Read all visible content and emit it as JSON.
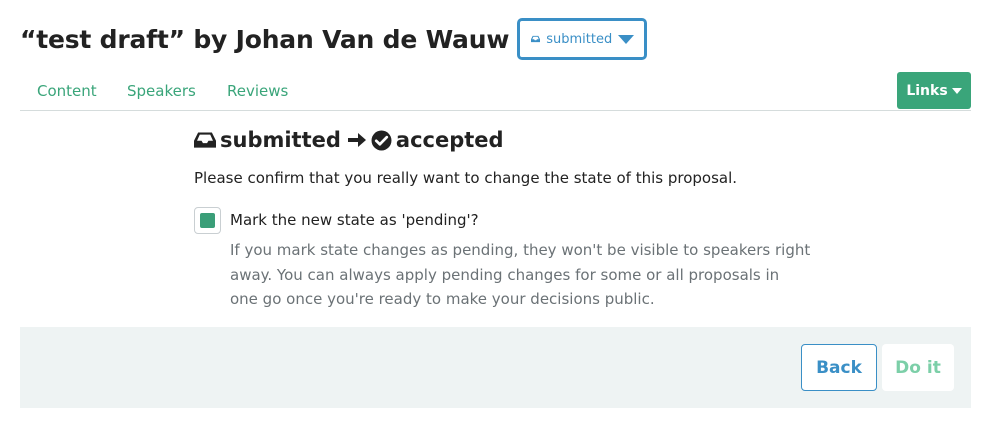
{
  "header": {
    "title": "“test draft” by Johan Van de Wauw",
    "state_dropdown": {
      "icon": "inbox-icon",
      "label": "submitted"
    }
  },
  "tabs": [
    {
      "label": "Content"
    },
    {
      "label": "Speakers"
    },
    {
      "label": "Reviews"
    }
  ],
  "links_button": {
    "label": "Links"
  },
  "transition": {
    "from_icon": "inbox-icon",
    "from": "submitted",
    "arrow_icon": "arrow-right-icon",
    "to_icon": "check-circle-icon",
    "to": "accepted"
  },
  "confirm_text": "Please confirm that you really want to change the state of this proposal.",
  "pending": {
    "checked": true,
    "label": "Mark the new state as 'pending'?",
    "help_lines": [
      "If you mark state changes as pending, they won't be visible to speakers right",
      "away. You can always apply pending changes for some or all proposals in",
      "one go once you're ready to make your decisions public."
    ]
  },
  "footer": {
    "back_label": "Back",
    "do_label": "Do it"
  },
  "colors": {
    "primary_blue": "#3a8fc6",
    "success_green": "#3aa57a",
    "footer_bg": "#eef3f3"
  }
}
